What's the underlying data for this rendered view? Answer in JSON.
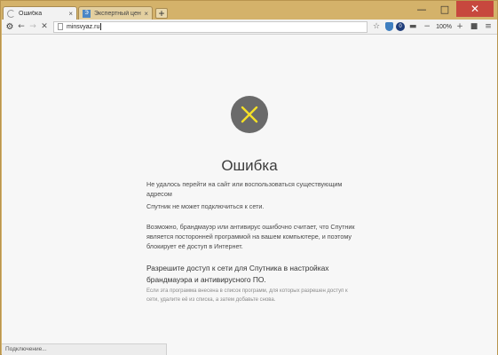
{
  "window": {
    "minimize_glyph": "—",
    "maximize_glyph": "□",
    "close_glyph": "✕"
  },
  "tabs": [
    {
      "title": "Ошибка",
      "active": true,
      "close_glyph": "×"
    },
    {
      "title": "Экспертный центр э",
      "active": false,
      "close_glyph": "×"
    }
  ],
  "new_tab_glyph": "+",
  "toolbar": {
    "menu_icon": "gear-icon",
    "back_glyph": "←",
    "forward_glyph": "→",
    "stop_glyph": "✕",
    "address_value": "minsvyaz.ru",
    "star_glyph": "☆",
    "ext_label": "0",
    "zoom_minus": "−",
    "zoom_level": "100%",
    "zoom_plus": "+"
  },
  "error_page": {
    "icon": "x-mark-icon",
    "title": "Ошибка",
    "line1": "Не удалось перейти на сайт или воспользоваться существующим адресом",
    "line2": "Спутник не может подключиться к сети.",
    "line3": "Возможно, брандмауэр или антивирус ошибочно считает, что Спутник является посторонней программой на вашем компьютере, и поэтому блокирует её доступ в Интернет.",
    "line4": "Разрешите доступ к сети для Спутника в настройках брандмауэра и антивирусного ПО.",
    "line5": "Если эта программа внесена в список программ, для которых разрешен доступ к сети, удалите её из списка, а затем добавьте снова."
  },
  "status": {
    "text": "Подключение..."
  },
  "colors": {
    "window_frame": "#d4b26a",
    "close_button": "#c7483e",
    "icon_circle": "#6a6a6a",
    "x_mark": "#f5e028"
  }
}
